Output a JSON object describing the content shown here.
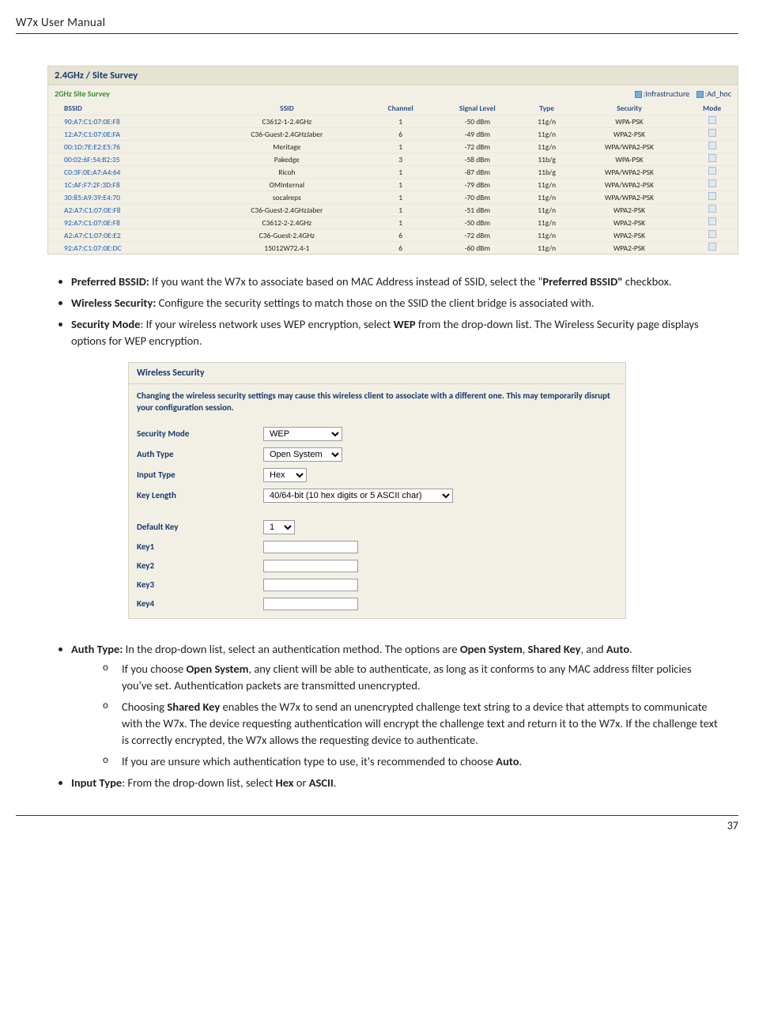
{
  "header": {
    "left": "W7x  User Manual"
  },
  "footer": {
    "page": "37"
  },
  "survey": {
    "title": "2.4GHz / Site Survey",
    "subtitle": "2GHz Site Survey",
    "legend_infra": ":Infrastructure",
    "legend_adhoc": ":Ad_hoc",
    "columns": {
      "bssid": "BSSID",
      "ssid": "SSID",
      "channel": "Channel",
      "signal": "Signal Level",
      "type": "Type",
      "security": "Security",
      "mode": "Mode"
    },
    "rows": [
      {
        "bssid": "90:A7:C1:07:0E:F8",
        "ssid": "C3612-1-2.4GHz",
        "channel": "1",
        "signal": "-50 dBm",
        "type": "11g/n",
        "security": "WPA-PSK"
      },
      {
        "bssid": "12:A7:C1:07:0E:FA",
        "ssid": "C36-Guest-2.4GHzJaber",
        "channel": "6",
        "signal": "-49 dBm",
        "type": "11g/n",
        "security": "WPA2-PSK"
      },
      {
        "bssid": "00:1D:7E:E2:E5:76",
        "ssid": "Meritage",
        "channel": "1",
        "signal": "-72 dBm",
        "type": "11g/n",
        "security": "WPA/WPA2-PSK"
      },
      {
        "bssid": "00:02:6F:54:B2:35",
        "ssid": "Pakedge",
        "channel": "3",
        "signal": "-58 dBm",
        "type": "11b/g",
        "security": "WPA-PSK"
      },
      {
        "bssid": "C0:3F:0E:A7:A4:64",
        "ssid": "Ricoh",
        "channel": "1",
        "signal": "-87 dBm",
        "type": "11b/g",
        "security": "WPA/WPA2-PSK"
      },
      {
        "bssid": "1C:AF:F7:2F:3D:F8",
        "ssid": "OMInternal",
        "channel": "1",
        "signal": "-79 dBm",
        "type": "11g/n",
        "security": "WPA/WPA2-PSK"
      },
      {
        "bssid": "30:85:A9:39:E4:70",
        "ssid": "socalreps",
        "channel": "1",
        "signal": "-70 dBm",
        "type": "11g/n",
        "security": "WPA/WPA2-PSK"
      },
      {
        "bssid": "A2:A7:C1:07:0E:F8",
        "ssid": "C36-Guest-2.4GHzJaber",
        "channel": "1",
        "signal": "-51 dBm",
        "type": "11g/n",
        "security": "WPA2-PSK"
      },
      {
        "bssid": "92:A7:C1:07:0E:F8",
        "ssid": "C3612-2-2.4GHz",
        "channel": "1",
        "signal": "-50 dBm",
        "type": "11g/n",
        "security": "WPA2-PSK"
      },
      {
        "bssid": "A2:A7:C1:07:0E:E2",
        "ssid": "C36-Guest-2.4GHz",
        "channel": "6",
        "signal": "-72 dBm",
        "type": "11g/n",
        "security": "WPA2-PSK"
      },
      {
        "bssid": "92:A7:C1:07:0E:DC",
        "ssid": "15012W72.4-1",
        "channel": "6",
        "signal": "-60 dBm",
        "type": "11g/n",
        "security": "WPA2-PSK"
      }
    ]
  },
  "bullets": {
    "pref_lead": "Preferred BSSID:",
    "pref_text_a": " If you want the W7x to associate based on MAC Address instead of SSID, select the \"",
    "pref_text_b": "Preferred BSSID\"",
    "pref_text_c": " checkbox.",
    "wsec_lead": "Wireless Security:",
    "wsec_text": " Configure the security settings to match those on the SSID the client bridge is associated with.",
    "smode_lead": "Security Mode",
    "smode_text_a": ": If your wireless network uses WEP encryption, select ",
    "smode_wep": "WEP",
    "smode_text_b": " from the drop-down list. The Wireless Security page displays options for WEP encryption.",
    "auth_lead": "Auth Type:",
    "auth_text_a": " In the drop-down list, select an authentication method. The options are ",
    "auth_open": "Open System",
    "auth_sep1": ", ",
    "auth_shared": "Shared Key",
    "auth_sep2": ", and ",
    "auth_auto": "Auto",
    "auth_period": ".",
    "sub1_a": "If you choose ",
    "sub1_open": "Open System",
    "sub1_b": ", any client will be able to authenticate, as long as it conforms to any MAC address filter policies you've set. Authentication packets are transmitted unencrypted.",
    "sub2_a": "Choosing ",
    "sub2_shared": "Shared Key",
    "sub2_b": " enables the W7x to send an unencrypted challenge text string to a device that attempts to communicate with the W7x. The device requesting authentication will encrypt the challenge text and return it to the W7x. If the challenge text is correctly encrypted, the W7x allows the requesting device to authenticate.",
    "sub3_a": "If you are unsure which authentication type to use, it's recommended to choose ",
    "sub3_auto": "Auto",
    "sub3_b": ".",
    "input_lead": "Input Type",
    "input_text_a": ": From the drop-down list, select ",
    "input_hex": "Hex",
    "input_or": " or ",
    "input_ascii": "ASCII",
    "input_period": "."
  },
  "sec_panel": {
    "title": "Wireless Security",
    "note": "Changing the wireless security settings may cause this wireless client to associate with a different one. This may temporarily disrupt your configuration session.",
    "security_mode_label": "Security Mode",
    "security_mode_value": "WEP",
    "auth_type_label": "Auth Type",
    "auth_type_value": "Open System",
    "input_type_label": "Input Type",
    "input_type_value": "Hex",
    "key_length_label": "Key Length",
    "key_length_value": "40/64-bit (10 hex digits or 5 ASCII char)",
    "default_key_label": "Default Key",
    "default_key_value": "1",
    "key1_label": "Key1",
    "key2_label": "Key2",
    "key3_label": "Key3",
    "key4_label": "Key4"
  }
}
